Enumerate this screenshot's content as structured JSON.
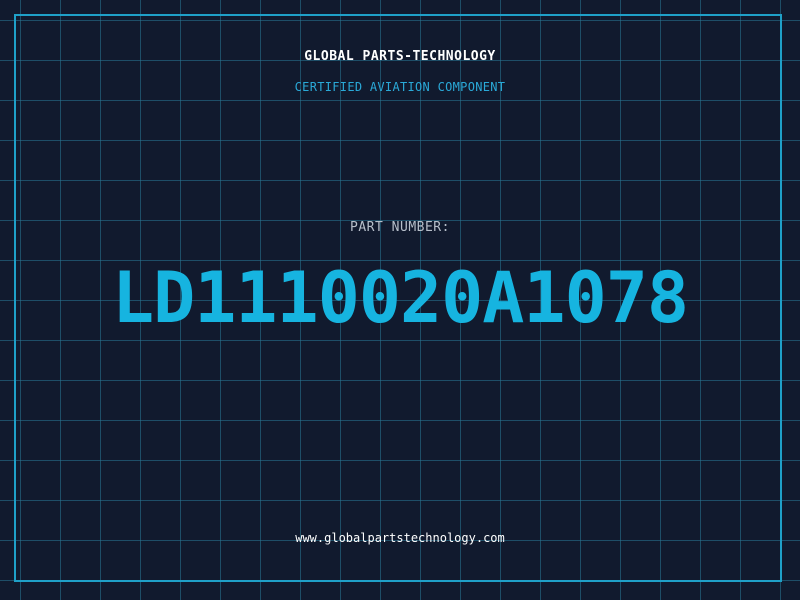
{
  "header": {
    "company": "GLOBAL PARTS-TECHNOLOGY",
    "subtitle": "CERTIFIED AVIATION COMPONENT"
  },
  "part": {
    "label": "PART NUMBER:",
    "number": "LD1110020A1078"
  },
  "footer": {
    "website": "www.globalpartstechnology.com"
  },
  "colors": {
    "background": "#111a2e",
    "grid": "#287896",
    "frame": "#1fa0c8",
    "accent": "#16b4e0",
    "label": "#b7bfca",
    "text": "#ffffff"
  }
}
